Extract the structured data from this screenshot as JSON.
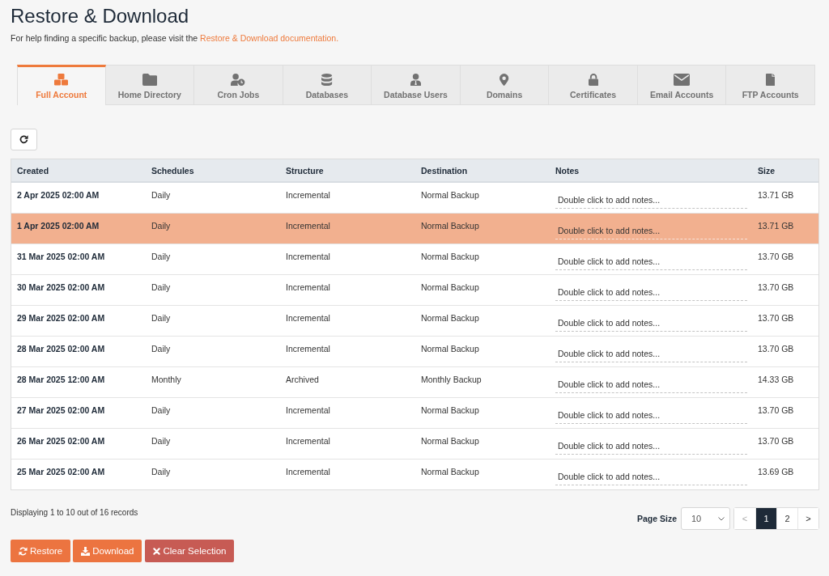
{
  "header": {
    "title": "Restore & Download",
    "help_text": "For help finding a specific backup, please visit the",
    "help_link": "Restore & Download documentation."
  },
  "tabs": [
    {
      "label": "Full Account",
      "selected": true
    },
    {
      "label": "Home Directory",
      "selected": false
    },
    {
      "label": "Cron Jobs",
      "selected": false
    },
    {
      "label": "Databases",
      "selected": false
    },
    {
      "label": "Database Users",
      "selected": false
    },
    {
      "label": "Domains",
      "selected": false
    },
    {
      "label": "Certificates",
      "selected": false
    },
    {
      "label": "Email Accounts",
      "selected": false
    },
    {
      "label": "FTP Accounts",
      "selected": false
    }
  ],
  "table": {
    "columns": [
      "Created",
      "Schedules",
      "Structure",
      "Destination",
      "Notes",
      "Size"
    ],
    "rows": [
      {
        "created": "2 Apr 2025 02:00 AM",
        "schedule": "Daily",
        "structure": "Incremental",
        "destination": "Normal Backup",
        "notes": {
          "placeholder": "Double click to add notes..."
        },
        "size": "13.71 GB",
        "selected": false
      },
      {
        "created": "1 Apr 2025 02:00 AM",
        "schedule": "Daily",
        "structure": "Incremental",
        "destination": "Normal Backup",
        "notes": {
          "placeholder": "Double click to add notes..."
        },
        "size": "13.71 GB",
        "selected": true
      },
      {
        "created": "31 Mar 2025 02:00 AM",
        "schedule": "Daily",
        "structure": "Incremental",
        "destination": "Normal Backup",
        "notes": {
          "placeholder": "Double click to add notes..."
        },
        "size": "13.70 GB",
        "selected": false
      },
      {
        "created": "30 Mar 2025 02:00 AM",
        "schedule": "Daily",
        "structure": "Incremental",
        "destination": "Normal Backup",
        "notes": {
          "placeholder": "Double click to add notes..."
        },
        "size": "13.70 GB",
        "selected": false
      },
      {
        "created": "29 Mar 2025 02:00 AM",
        "schedule": "Daily",
        "structure": "Incremental",
        "destination": "Normal Backup",
        "notes": {
          "placeholder": "Double click to add notes..."
        },
        "size": "13.70 GB",
        "selected": false
      },
      {
        "created": "28 Mar 2025 02:00 AM",
        "schedule": "Daily",
        "structure": "Incremental",
        "destination": "Normal Backup",
        "notes": {
          "placeholder": "Double click to add notes..."
        },
        "size": "13.70 GB",
        "selected": false
      },
      {
        "created": "28 Mar 2025 12:00 AM",
        "schedule": "Monthly",
        "structure": "Archived",
        "destination": "Monthly Backup",
        "notes": {
          "placeholder": "Double click to add notes..."
        },
        "size": "14.33 GB",
        "selected": false
      },
      {
        "created": "27 Mar 2025 02:00 AM",
        "schedule": "Daily",
        "structure": "Incremental",
        "destination": "Normal Backup",
        "notes": {
          "placeholder": "Double click to add notes..."
        },
        "size": "13.70 GB",
        "selected": false
      },
      {
        "created": "26 Mar 2025 02:00 AM",
        "schedule": "Daily",
        "structure": "Incremental",
        "destination": "Normal Backup",
        "notes": {
          "placeholder": "Double click to add notes..."
        },
        "size": "13.70 GB",
        "selected": false
      },
      {
        "created": "25 Mar 2025 02:00 AM",
        "schedule": "Daily",
        "structure": "Incremental",
        "destination": "Normal Backup",
        "notes": {
          "placeholder": "Double click to add notes..."
        },
        "size": "13.69 GB",
        "selected": false
      }
    ]
  },
  "footer": {
    "record_count": "Displaying 1 to 10 out of 16 records",
    "page_size": {
      "label": "Page Size",
      "value": "10"
    },
    "pagination": [
      {
        "label": "<",
        "selected": false,
        "disabled": true
      },
      {
        "label": "1",
        "selected": true,
        "disabled": false
      },
      {
        "label": "2",
        "selected": false,
        "disabled": false
      },
      {
        "label": ">",
        "selected": false,
        "disabled": false
      }
    ]
  },
  "actions": [
    {
      "label": "Restore",
      "kind": "primary"
    },
    {
      "label": "Download",
      "kind": "primary"
    },
    {
      "label": "Clear Selection",
      "kind": "danger"
    }
  ]
}
